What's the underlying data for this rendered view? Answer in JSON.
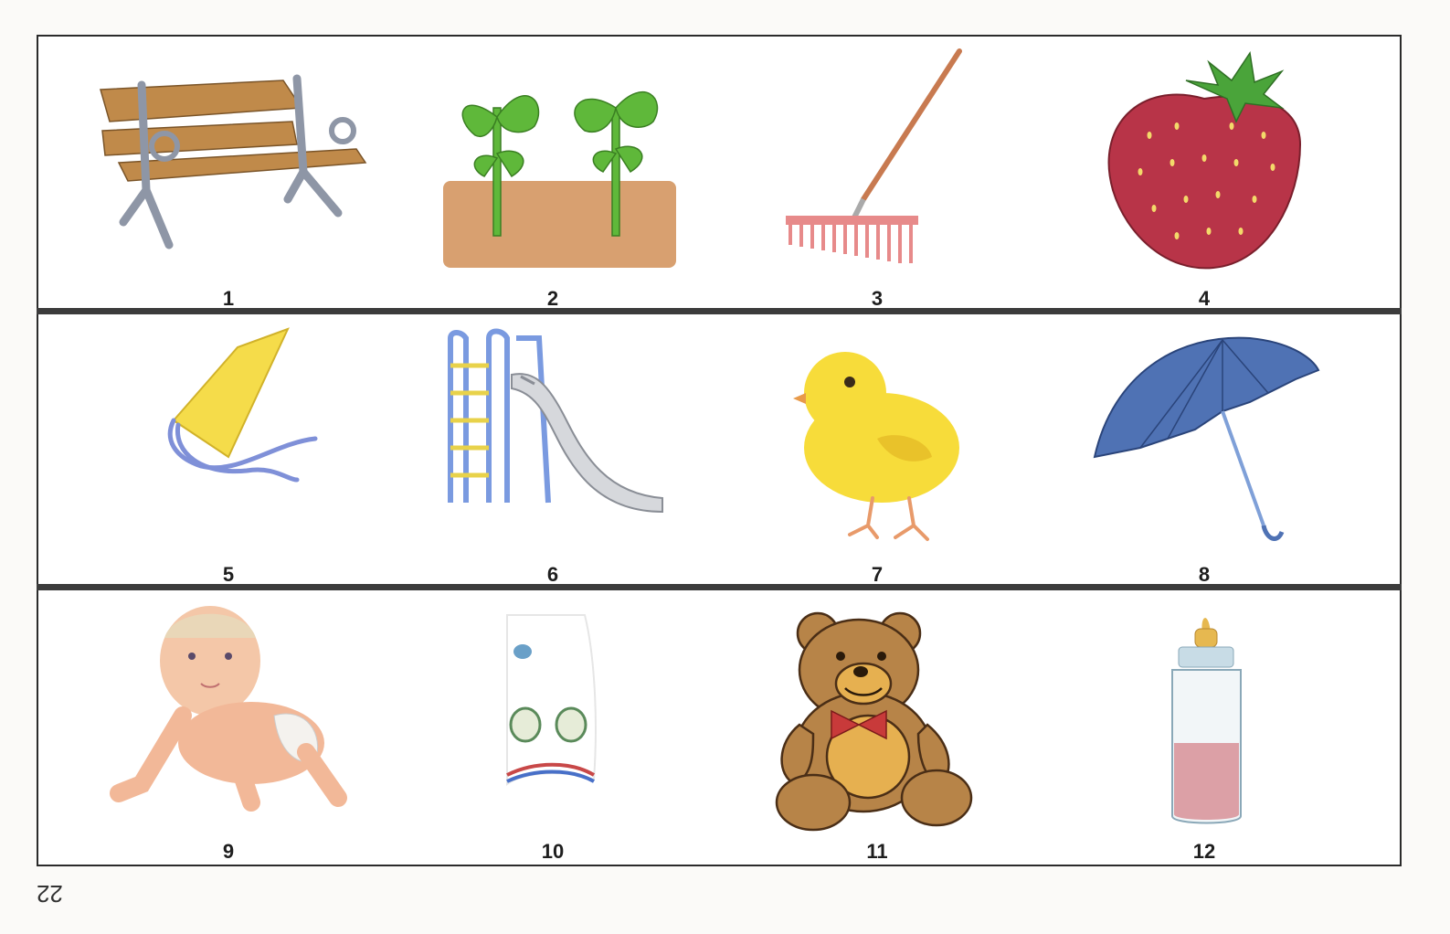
{
  "page_number": "22",
  "items": [
    {
      "number": "1",
      "icon": "bench-icon"
    },
    {
      "number": "2",
      "icon": "seedlings-icon"
    },
    {
      "number": "3",
      "icon": "rake-icon"
    },
    {
      "number": "4",
      "icon": "strawberry-icon"
    },
    {
      "number": "5",
      "icon": "kite-icon"
    },
    {
      "number": "6",
      "icon": "slide-icon"
    },
    {
      "number": "7",
      "icon": "chick-icon"
    },
    {
      "number": "8",
      "icon": "umbrella-icon"
    },
    {
      "number": "9",
      "icon": "baby-icon"
    },
    {
      "number": "10",
      "icon": "sock-icon"
    },
    {
      "number": "11",
      "icon": "teddy-bear-icon"
    },
    {
      "number": "12",
      "icon": "baby-bottle-icon"
    }
  ]
}
